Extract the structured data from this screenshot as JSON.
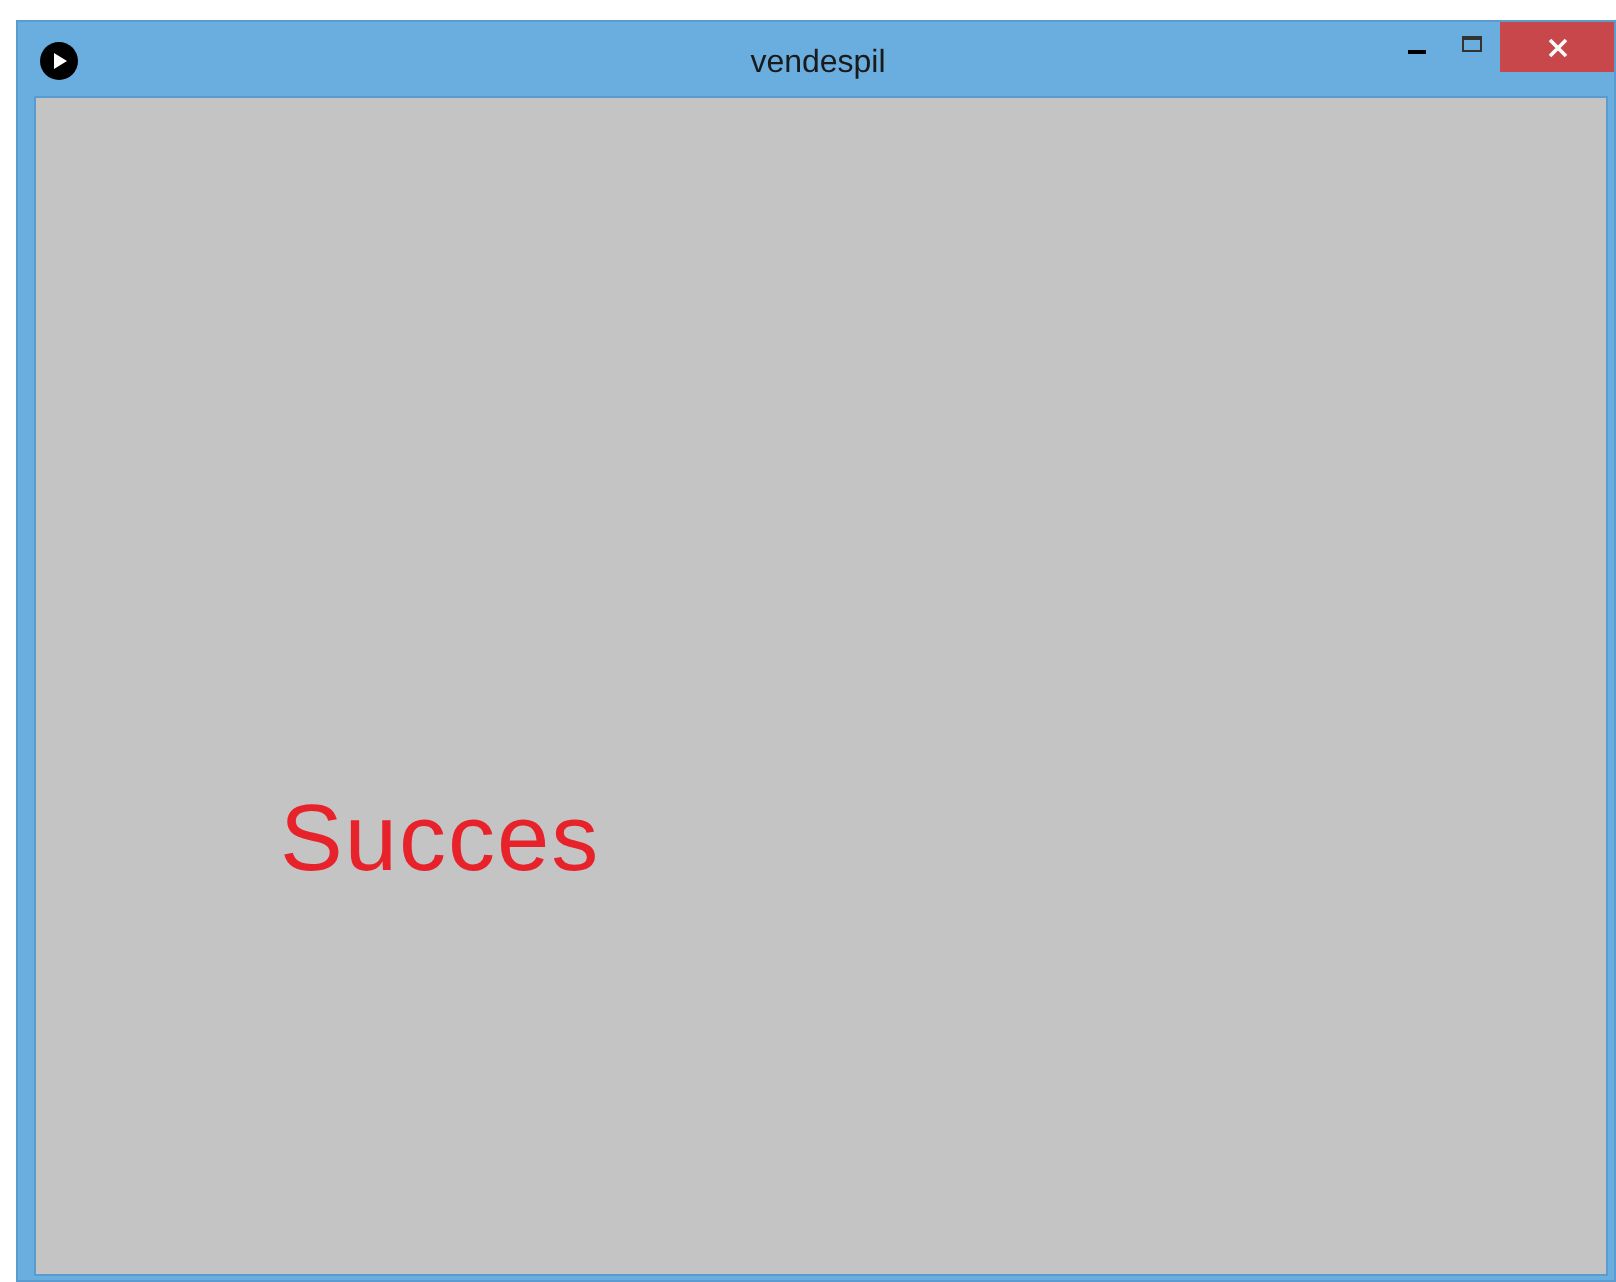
{
  "window": {
    "title": "vendespil"
  },
  "canvas": {
    "message": "Succes"
  }
}
